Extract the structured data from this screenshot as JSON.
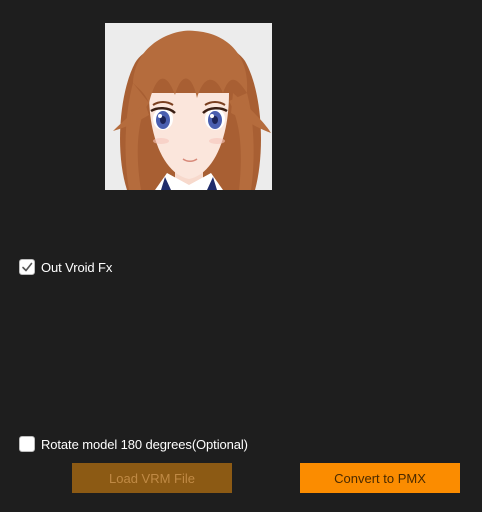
{
  "options": {
    "out_vroid_fx": {
      "label": "Out Vroid Fx",
      "checked": true
    },
    "rotate_model": {
      "label": "Rotate model 180 degrees(Optional)",
      "checked": false
    }
  },
  "buttons": {
    "load_label": "Load VRM File",
    "convert_label": "Convert to PMX"
  },
  "colors": {
    "background": "#1e1e1e",
    "load_button_bg": "#8c5a14",
    "load_button_text": "#c08a45",
    "convert_button_bg": "#fb8c00",
    "convert_button_text": "#4a2a00",
    "hair": "#b0683a",
    "eyes": "#4a5fb0",
    "skin": "#fbe6dc"
  },
  "preview": {
    "icon": "avatar-thumbnail"
  }
}
